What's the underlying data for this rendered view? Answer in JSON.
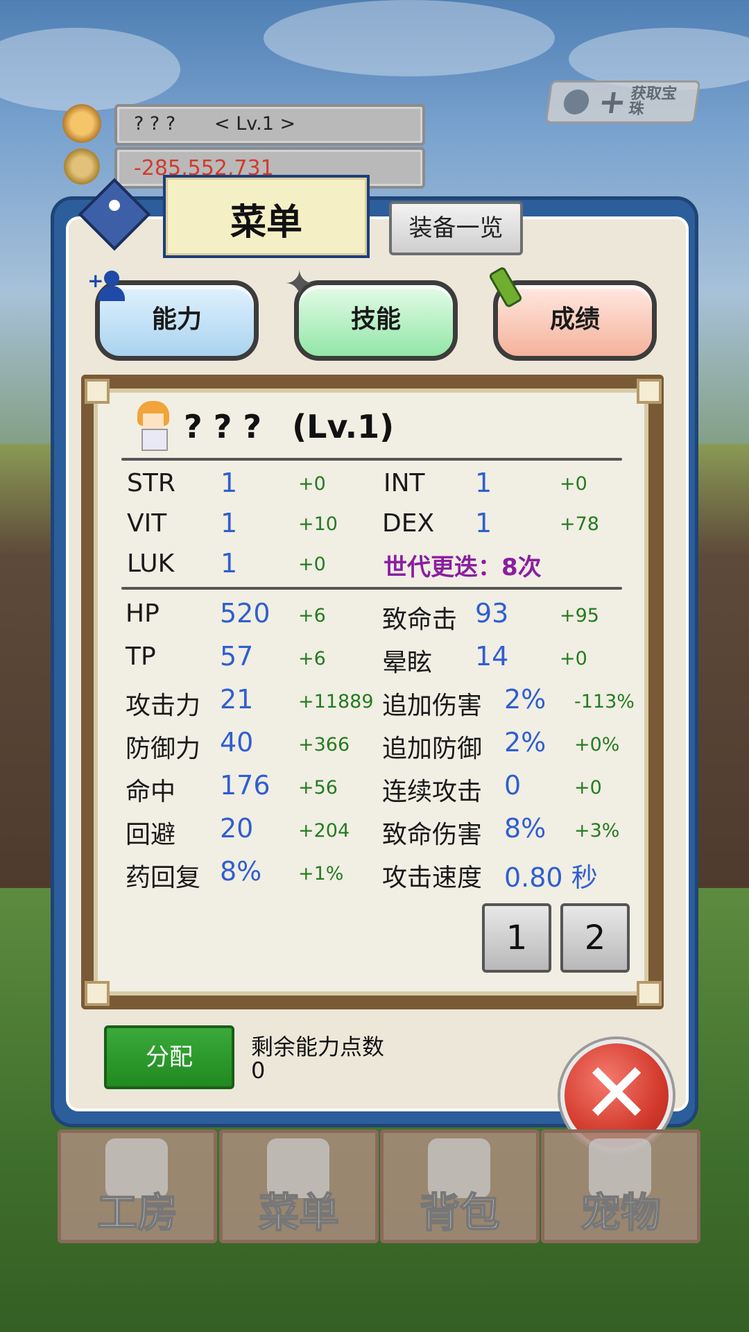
{
  "hud": {
    "player_name": "? ? ?",
    "player_level": "< Lv.1 >",
    "gold": "-285,552,731",
    "gem_button_label": "获取宝珠"
  },
  "panel": {
    "title": "菜单",
    "equip_button": "装备一览",
    "tabs": [
      {
        "label": "能力"
      },
      {
        "label": "技能"
      },
      {
        "label": "成绩"
      }
    ]
  },
  "stats": {
    "header_name": "? ? ?",
    "header_level": "(Lv.1)",
    "base": [
      {
        "label": "STR",
        "value": "1",
        "bonus": "+0"
      },
      {
        "label": "INT",
        "value": "1",
        "bonus": "+0"
      },
      {
        "label": "VIT",
        "value": "1",
        "bonus": "+10"
      },
      {
        "label": "DEX",
        "value": "1",
        "bonus": "+78"
      },
      {
        "label": "LUK",
        "value": "1",
        "bonus": "+0"
      }
    ],
    "generation": "世代更迭：8次",
    "combat_left": [
      {
        "label": "HP",
        "value": "520",
        "bonus": "+6"
      },
      {
        "label": "TP",
        "value": "57",
        "bonus": "+6"
      },
      {
        "label": "攻击力",
        "value": "21",
        "bonus": "+11889"
      },
      {
        "label": "防御力",
        "value": "40",
        "bonus": "+366"
      },
      {
        "label": "命中",
        "value": "176",
        "bonus": "+56"
      },
      {
        "label": "回避",
        "value": "20",
        "bonus": "+204"
      },
      {
        "label": "药回复",
        "value": "8%",
        "bonus": "+1%"
      }
    ],
    "combat_right": [
      {
        "label": "致命击",
        "value": "93",
        "bonus": "+95"
      },
      {
        "label": "晕眩",
        "value": "14",
        "bonus": "+0"
      },
      {
        "label": "追加伤害",
        "value": "2%",
        "bonus": "-113%"
      },
      {
        "label": "追加防御",
        "value": "2%",
        "bonus": "+0%"
      },
      {
        "label": "连续攻击",
        "value": "0",
        "bonus": "+0"
      },
      {
        "label": "致命伤害",
        "value": "8%",
        "bonus": "+3%"
      },
      {
        "label": "攻击速度",
        "value": "0.80 秒",
        "bonus": ""
      }
    ],
    "pages": [
      "1",
      "2"
    ]
  },
  "allocation": {
    "button": "分配",
    "remaining_label": "剩余能力点数",
    "remaining_value": "0"
  },
  "bottom_nav": [
    {
      "label": "工房",
      "icon": "workshop-icon"
    },
    {
      "label": "菜单",
      "icon": "book-icon"
    },
    {
      "label": "背包",
      "icon": "backpack-icon"
    },
    {
      "label": "宠物",
      "icon": "pet-icon"
    }
  ],
  "colors": {
    "panel_border": "#2c5e9b",
    "stat_value": "#2f5fd0",
    "stat_bonus": "#247c1f",
    "generation": "#8a1fa0",
    "gold_negative": "#d23a2c"
  }
}
